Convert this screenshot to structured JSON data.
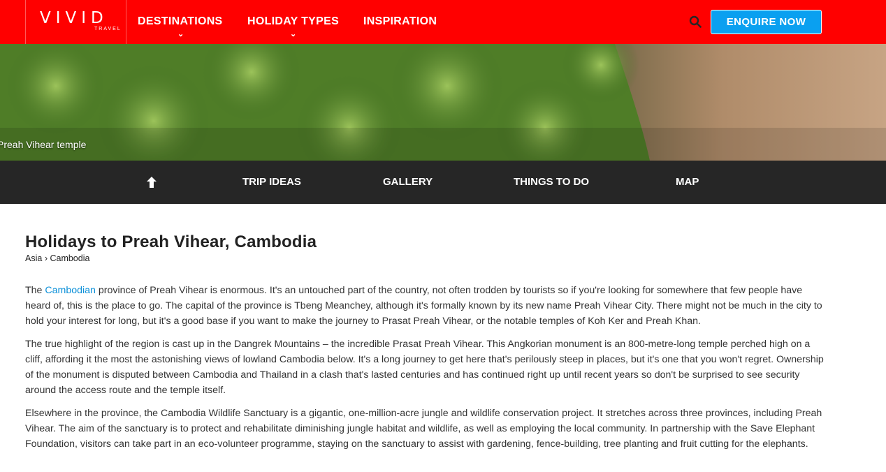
{
  "header": {
    "logo_main": "VIVID",
    "logo_sub": "TRAVEL",
    "nav": [
      {
        "label": "DESTINATIONS",
        "has_dropdown": true
      },
      {
        "label": "HOLIDAY TYPES",
        "has_dropdown": true
      },
      {
        "label": "INSPIRATION",
        "has_dropdown": false
      }
    ],
    "search_icon": "search-icon",
    "enquire_label": "ENQUIRE NOW"
  },
  "hero": {
    "caption": "Preah Vihear temple"
  },
  "subnav": {
    "up_icon": "arrow-up-icon",
    "items": [
      "TRIP IDEAS",
      "GALLERY",
      "THINGS TO DO",
      "MAP"
    ]
  },
  "main": {
    "title": "Holidays to Preah Vihear, Cambodia",
    "breadcrumb": [
      "Asia",
      "›",
      "Cambodia"
    ],
    "para1": {
      "before": "The ",
      "link": "Cambodian",
      "after": " province of Preah Vihear is enormous. It's an untouched part of the country, not often trodden by tourists so if you're looking for somewhere that few people have heard of, this is the place to go. The capital of the province is Tbeng Meanchey, although it's formally known by its new name Preah Vihear City. There might not be much in the city to hold your interest for long, but it's a good base if you want to make the journey to Prasat Preah Vihear, or the notable temples of Koh Ker and Preah Khan."
    },
    "para2": "The true highlight of the region is cast up in the Dangrek Mountains – the incredible Prasat Preah Vihear. This Angkorian monument is an 800-metre-long temple perched high on a cliff, affording it the most the astonishing views of lowland Cambodia below. It's a long journey to get here that's perilously steep in places, but it's one that you won't regret. Ownership of the monument is disputed between Cambodia and Thailand in a clash that's lasted centuries and has continued right up until recent years so don't be surprised to see security around the access route and the temple itself.",
    "para3": "Elsewhere in the province, the Cambodia Wildlife Sanctuary is a gigantic, one-million-acre jungle and wildlife conservation project. It stretches across three provinces, including Preah Vihear. The aim of the sanctuary is to protect and rehabilitate diminishing jungle habitat and wildlife, as well as employing the local community. In partnership with the Save Elephant Foundation, visitors can take part in an eco-volunteer programme, staying on the sanctuary to assist with gardening, fence-building, tree planting and fruit cutting for the elephants."
  },
  "colors": {
    "header_bg": "#ff0000",
    "enquire_bg": "#0aa0f0",
    "subnav_bg": "#262626",
    "link": "#0a8fd8"
  }
}
